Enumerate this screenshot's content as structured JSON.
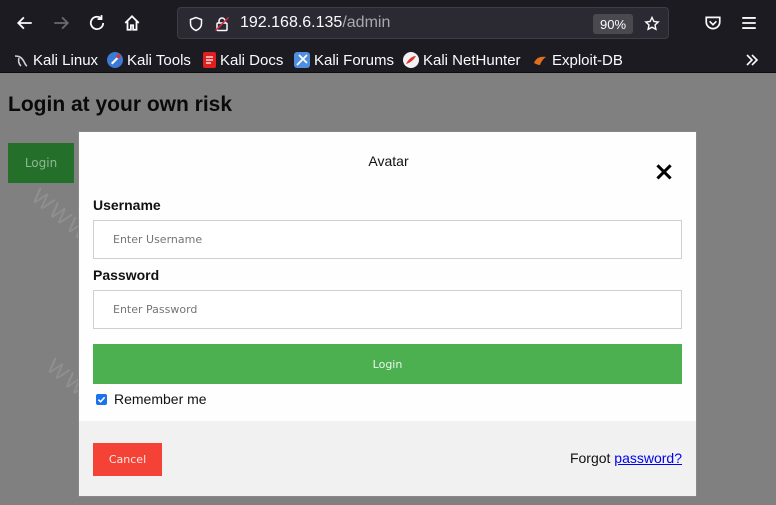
{
  "browser": {
    "url_host": "192.168.6.135",
    "url_path": "/admin",
    "zoom": "90%",
    "icons": {
      "back": "arrow-left-icon",
      "forward": "arrow-right-icon",
      "reload": "reload-icon",
      "home": "home-icon",
      "shield": "shield-icon",
      "insecure": "insecure-lock-icon",
      "bookmark": "star-icon",
      "pocket": "pocket-icon",
      "menu": "hamburger-menu-icon",
      "overflow": "double-chevron-icon"
    }
  },
  "bookmarks": [
    {
      "label": "Kali Linux",
      "icon": "kali-dragon-icon",
      "color": "#d0d0d0"
    },
    {
      "label": "Kali Tools",
      "icon": "kali-tools-icon",
      "color": "#3a7bd5"
    },
    {
      "label": "Kali Docs",
      "icon": "kali-docs-icon",
      "color": "#e02020"
    },
    {
      "label": "Kali Forums",
      "icon": "kali-forums-icon",
      "color": "#4f8fe0"
    },
    {
      "label": "Kali NetHunter",
      "icon": "nethunter-icon",
      "color": "#e03030"
    },
    {
      "label": "Exploit-DB",
      "icon": "exploit-db-icon",
      "color": "#e07020"
    }
  ],
  "page": {
    "title": "Login at your own risk",
    "login_button": "Login",
    "watermark": "WWW.2BA.CC"
  },
  "modal": {
    "caption": "Avatar",
    "close_symbol": "×",
    "username_label": "Username",
    "username_placeholder": "Enter Username",
    "username_value": "",
    "password_label": "Password",
    "password_placeholder": "Enter Password",
    "password_value": "",
    "login_button": "Login",
    "remember_label": "Remember me",
    "remember_checked": true,
    "cancel_button": "Cancel",
    "forgot_text": "Forgot",
    "forgot_link": "password?"
  },
  "colors": {
    "login_green": "#4caf50",
    "cancel_red": "#f44336",
    "link_blue": "#0000ee",
    "browser_chrome": "#1c1b22"
  }
}
